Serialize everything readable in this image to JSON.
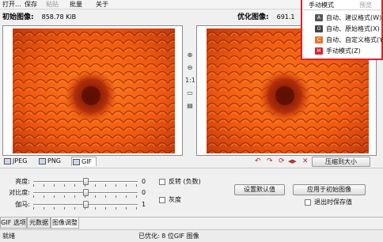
{
  "menu": {
    "items": [
      "打开...",
      "保存",
      "粘贴",
      "批量",
      "关于"
    ],
    "disabled": [
      false,
      false,
      true,
      false,
      false
    ]
  },
  "panes": {
    "original": {
      "title": "初始图像:",
      "size": "858.78 KiB"
    },
    "optimized": {
      "title": "优化图像:",
      "size": "691.1"
    }
  },
  "mid_tools": [
    "⊕",
    "⊖",
    "1:1",
    "▭",
    "▤"
  ],
  "format_tabs": [
    {
      "label": "JPEG"
    },
    {
      "label": "PNG"
    },
    {
      "label": "GIF"
    }
  ],
  "right_tools": [
    "↶",
    "↷",
    "⟳",
    "◀▶",
    "✕"
  ],
  "compress_button": "压缩到大小",
  "adjust": {
    "brightness": {
      "label": "亮度:",
      "value": "0",
      "level": 0.5
    },
    "contrast": {
      "label": "对比度:",
      "value": "0",
      "level": 0.5
    },
    "gamma": {
      "label": "伽马:",
      "value": "1",
      "level": 0.5
    },
    "invert_label": "反转 (负数)",
    "grayscale_label": "灰度",
    "reset_button": "设置默认值",
    "apply_button": "应用于初始图像",
    "save_on_exit_label": "退出时保存值"
  },
  "bottom_tabs": [
    "GIF 选项",
    "元数据",
    "图像调整"
  ],
  "status": {
    "left": "就绪",
    "center": "已优化: 8 位GIF 图像"
  },
  "dropdown": {
    "title": "手动模式",
    "gray": "预览",
    "items": [
      {
        "icon": "A",
        "label": "自动、建议格式(W)",
        "color": "#555555"
      },
      {
        "icon": "O",
        "label": "自动、原始格式(X)",
        "color": "#444444"
      },
      {
        "icon": "C",
        "label": "自动、自定义格式(Y",
        "color": "#e8762b"
      },
      {
        "icon": "M",
        "label": "手动模式(Z)",
        "color": "#d9232a"
      }
    ]
  }
}
